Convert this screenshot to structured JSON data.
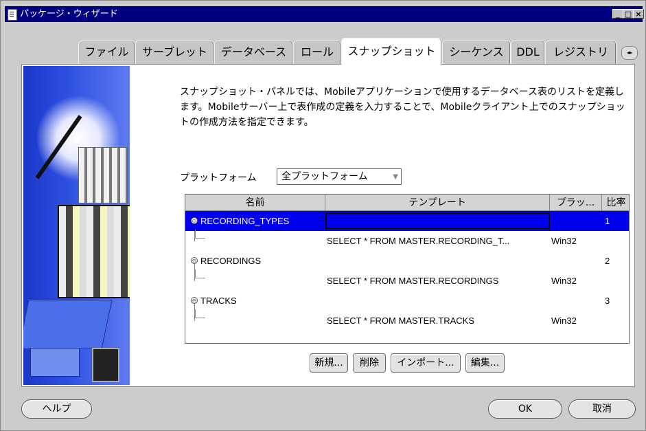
{
  "window": {
    "title": "パッケージ・ウィザード",
    "min_glyph": "_",
    "max_glyph": "□",
    "close_glyph": "×"
  },
  "tabs": [
    {
      "label": "ファイル"
    },
    {
      "label": "サーブレット"
    },
    {
      "label": "データベース"
    },
    {
      "label": "ロール"
    },
    {
      "label": "スナップショット",
      "active": true
    },
    {
      "label": "シーケンス"
    },
    {
      "label": "DDL"
    },
    {
      "label": "レジストリ"
    }
  ],
  "tab_scroll_glyph": "◂▸",
  "description": "スナップショット・パネルでは、Mobileアプリケーションで使用するデータベース表のリストを定義します。Mobileサーバー上で表作成の定義を入力することで、Mobileクライアント上でのスナップショットの作成方法を指定できます。",
  "platform": {
    "label": "プラットフォーム",
    "selected": "全プラットフォーム"
  },
  "table": {
    "headers": {
      "name": "名前",
      "template": "テンプレート",
      "platform": "プラッ...",
      "ratio": "比率"
    },
    "rows": [
      {
        "name": "RECORDING_TYPES",
        "template": "",
        "platform": "",
        "ratio": "1",
        "selected": true,
        "kind": "parent"
      },
      {
        "name": "",
        "template": "SELECT * FROM MASTER.RECORDING_T...",
        "platform": "Win32",
        "ratio": "",
        "kind": "child"
      },
      {
        "name": "RECORDINGS",
        "template": "",
        "platform": "",
        "ratio": "2",
        "kind": "parent"
      },
      {
        "name": "",
        "template": "SELECT * FROM MASTER.RECORDINGS",
        "platform": "Win32",
        "ratio": "",
        "kind": "child"
      },
      {
        "name": "TRACKS",
        "template": "",
        "platform": "",
        "ratio": "3",
        "kind": "parent"
      },
      {
        "name": "",
        "template": "SELECT * FROM MASTER.TRACKS",
        "platform": "Win32",
        "ratio": "",
        "kind": "child"
      }
    ]
  },
  "buttons": {
    "new": "新規...",
    "delete": "削除",
    "import": "インポート...",
    "edit": "編集..."
  },
  "footer": {
    "help": "ヘルプ",
    "ok": "OK",
    "cancel": "取消"
  },
  "colors": {
    "titlebar": "#000080",
    "selection": "#0000ee",
    "background": "#cccccc"
  }
}
